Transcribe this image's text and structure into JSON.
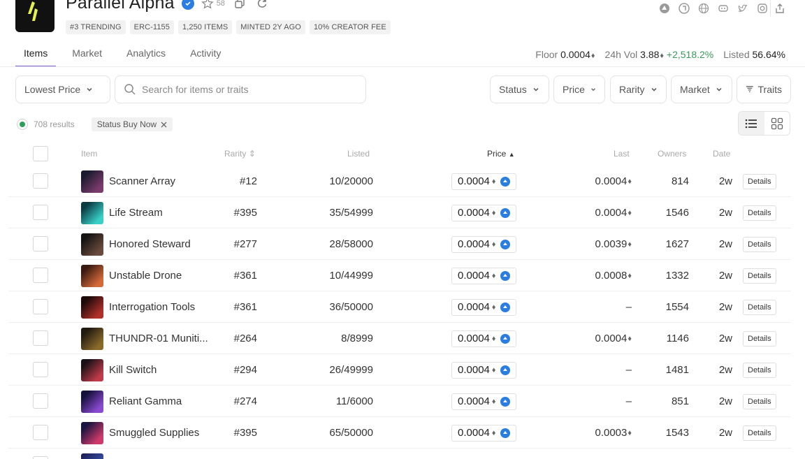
{
  "header": {
    "title": "Parallel Alpha",
    "star_count": "58",
    "tags": [
      "#3 TRENDING",
      "ERC-1155",
      "1,250 ITEMS",
      "MINTED 2Y AGO",
      "10% CREATOR FEE"
    ],
    "social_icons": [
      "opensea-icon",
      "coinbase-icon",
      "globe-icon",
      "discord-icon",
      "twitter-icon",
      "instagram-icon"
    ]
  },
  "tabs": [
    {
      "label": "Items",
      "active": true
    },
    {
      "label": "Market",
      "active": false
    },
    {
      "label": "Analytics",
      "active": false
    },
    {
      "label": "Activity",
      "active": false
    }
  ],
  "stats": {
    "floor_label": "Floor",
    "floor_value": "0.0004",
    "vol_label": "24h Vol",
    "vol_value": "3.88",
    "vol_change": "+2,518.2%",
    "listed_label": "Listed",
    "listed_value": "56.64%"
  },
  "filters": {
    "sort": "Lowest Price",
    "search_placeholder": "Search for items or traits",
    "status": "Status",
    "price": "Price",
    "rarity": "Rarity",
    "market": "Market",
    "traits": "Traits"
  },
  "results": {
    "count": "708 results",
    "chip": "Status Buy Now"
  },
  "columns": {
    "item": "Item",
    "rarity": "Rarity",
    "listed": "Listed",
    "price": "Price",
    "last": "Last",
    "owners": "Owners",
    "date": "Date"
  },
  "colors": {
    "accent": "#7b5cc9",
    "positive": "#3a9a5a",
    "link": "#3c6fd0",
    "rarity_top": "#b23cbf",
    "coin": "#2a7de1"
  },
  "rows": [
    {
      "name": "Scanner Array",
      "rarity": "#12",
      "listed": "10/20000",
      "price": "0.0004",
      "last": "0.0004",
      "owners": "814",
      "date": "2w",
      "details": "Details",
      "thumb": [
        "#1a1a2e",
        "#7a3b6b"
      ]
    },
    {
      "name": "Life Stream",
      "rarity": "#395",
      "listed": "35/54999",
      "price": "0.0004",
      "last": "0.0004",
      "owners": "1546",
      "date": "2w",
      "details": "Details",
      "thumb": [
        "#0b3c44",
        "#38d0c8"
      ]
    },
    {
      "name": "Honored Steward",
      "rarity": "#277",
      "listed": "28/58000",
      "price": "0.0004",
      "last": "0.0039",
      "owners": "1627",
      "date": "2w",
      "details": "Details",
      "thumb": [
        "#141414",
        "#6a4a3c"
      ]
    },
    {
      "name": "Unstable Drone",
      "rarity": "#361",
      "listed": "10/44999",
      "price": "0.0004",
      "last": "0.0008",
      "owners": "1332",
      "date": "2w",
      "details": "Details",
      "thumb": [
        "#3a1a10",
        "#d46a3a"
      ]
    },
    {
      "name": "Interrogation Tools",
      "rarity": "#361",
      "listed": "36/50000",
      "price": "0.0004",
      "last": "–",
      "owners": "1554",
      "date": "2w",
      "details": "Details",
      "thumb": [
        "#1c0a0a",
        "#b0302a"
      ]
    },
    {
      "name": "THUNDR-01 Muniti...",
      "rarity": "#264",
      "listed": "8/8999",
      "price": "0.0004",
      "last": "0.0004",
      "owners": "1146",
      "date": "2w",
      "details": "Details",
      "thumb": [
        "#201a10",
        "#8a6a2a"
      ]
    },
    {
      "name": "Kill Switch",
      "rarity": "#294",
      "listed": "26/49999",
      "price": "0.0004",
      "last": "–",
      "owners": "1481",
      "date": "2w",
      "details": "Details",
      "thumb": [
        "#1a1216",
        "#c03a4a"
      ]
    },
    {
      "name": "Reliant Gamma",
      "rarity": "#274",
      "listed": "11/6000",
      "price": "0.0004",
      "last": "–",
      "owners": "851",
      "date": "2w",
      "details": "Details",
      "thumb": [
        "#14103a",
        "#8a4ad0"
      ]
    },
    {
      "name": "Smuggled Supplies",
      "rarity": "#395",
      "listed": "65/50000",
      "price": "0.0004",
      "last": "0.0003",
      "owners": "1543",
      "date": "2w",
      "details": "Details",
      "thumb": [
        "#1a1440",
        "#d03a6a"
      ]
    }
  ]
}
